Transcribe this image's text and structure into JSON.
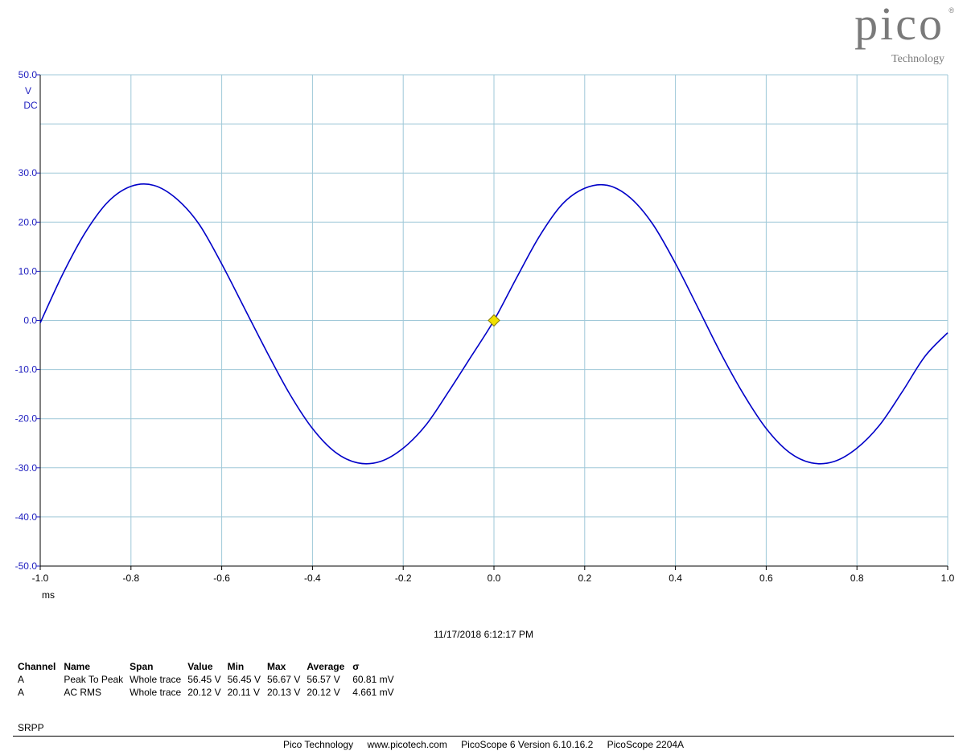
{
  "logo": {
    "word": "pico",
    "registered": "®",
    "sub": "Technology"
  },
  "chart_data": {
    "type": "line",
    "x_unit": "ms",
    "y_unit": "V",
    "y_coupling": "DC",
    "xlim": [
      -1.0,
      1.0
    ],
    "ylim": [
      -50.0,
      50.0
    ],
    "x_ticks": [
      "-1.0",
      "-0.8",
      "-0.6",
      "-0.4",
      "-0.2",
      "0.0",
      "0.2",
      "0.4",
      "0.6",
      "0.8",
      "1.0"
    ],
    "y_ticks": [
      "50.0",
      "30.0",
      "20.0",
      "10.0",
      "0.0",
      "-10.0",
      "-20.0",
      "-30.0",
      "-40.0",
      "-50.0"
    ],
    "grid": true,
    "series": [
      {
        "channel": "A",
        "color": "#0000c8",
        "x": [
          -1.0,
          -0.95,
          -0.9,
          -0.85,
          -0.8,
          -0.75,
          -0.7,
          -0.65,
          -0.6,
          -0.55,
          -0.5,
          -0.45,
          -0.4,
          -0.35,
          -0.3,
          -0.25,
          -0.2,
          -0.15,
          -0.1,
          -0.05,
          0.0,
          0.05,
          0.1,
          0.15,
          0.2,
          0.25,
          0.3,
          0.35,
          0.4,
          0.45,
          0.5,
          0.55,
          0.6,
          0.65,
          0.7,
          0.75,
          0.8,
          0.85,
          0.9,
          0.95,
          1.0
        ],
        "y": [
          -0.5,
          9.5,
          18.0,
          24.2,
          27.3,
          27.5,
          24.8,
          19.6,
          11.5,
          2.5,
          -6.5,
          -15.0,
          -22.0,
          -26.8,
          -29.0,
          -28.7,
          -26.0,
          -21.3,
          -14.5,
          -7.3,
          0.0,
          8.7,
          17.1,
          23.6,
          26.9,
          27.5,
          25.0,
          19.6,
          11.6,
          2.5,
          -6.7,
          -15.0,
          -22.0,
          -26.8,
          -29.0,
          -28.7,
          -26.0,
          -21.3,
          -14.5,
          -7.3,
          -2.5
        ]
      }
    ],
    "trigger_marker": {
      "x": 0.0,
      "y": 0.0,
      "color": "#f0e000"
    }
  },
  "timestamp": "11/17/2018 6:12:17 PM",
  "measurements": {
    "headers": [
      "Channel",
      "Name",
      "Span",
      "Value",
      "Min",
      "Max",
      "Average",
      "σ"
    ],
    "rows": [
      [
        "A",
        "Peak To Peak",
        "Whole trace",
        "56.45 V",
        "56.45 V",
        "56.67 V",
        "56.57 V",
        "60.81 mV"
      ],
      [
        "A",
        "AC RMS",
        "Whole trace",
        "20.12 V",
        "20.11 V",
        "20.13 V",
        "20.12 V",
        "4.661 mV"
      ]
    ]
  },
  "notes": "SRPP",
  "footer": [
    "Pico Technology",
    "www.picotech.com",
    "PicoScope 6 Version 6.10.16.2",
    "PicoScope 2204A"
  ]
}
